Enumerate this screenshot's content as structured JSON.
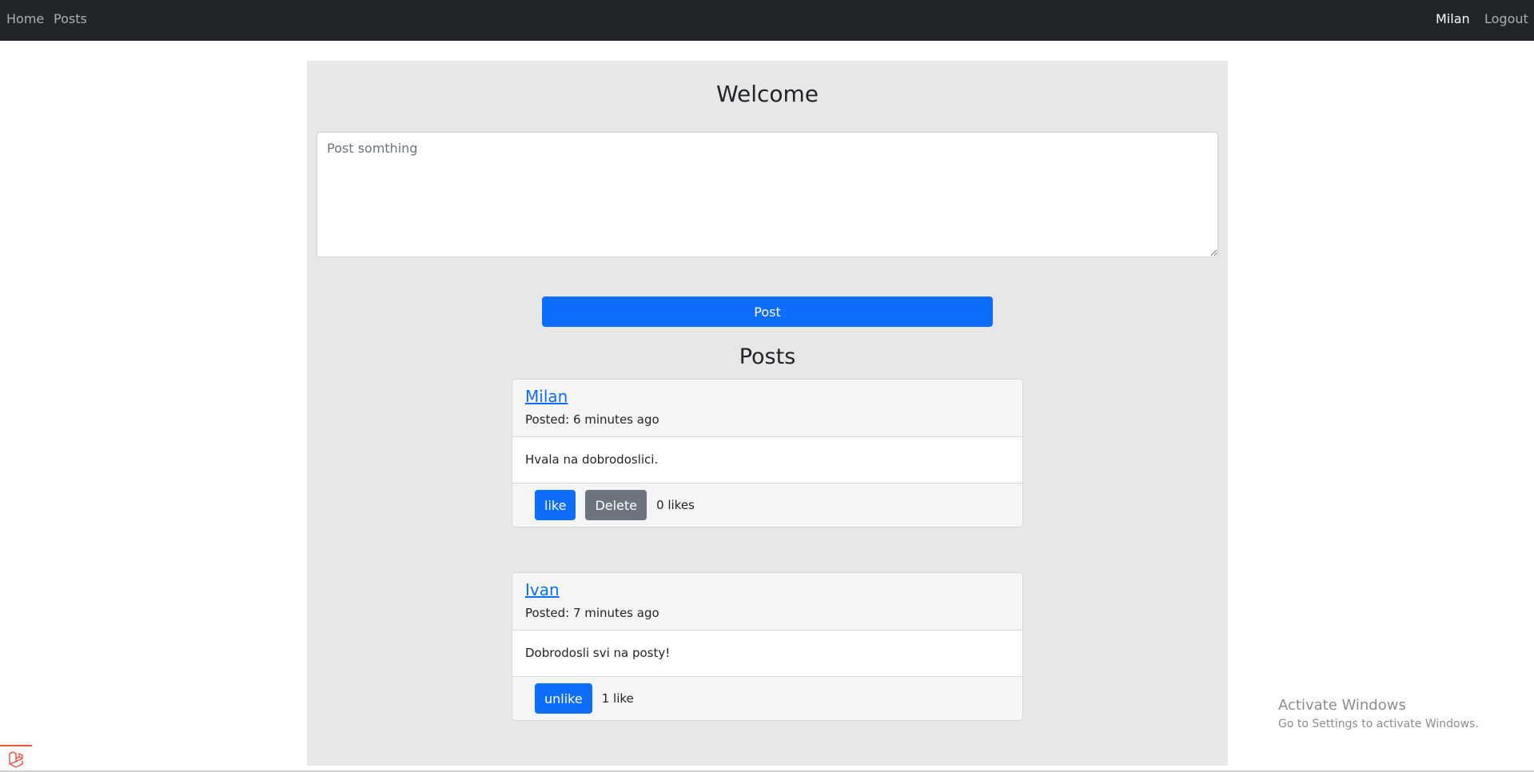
{
  "navbar": {
    "home_label": "Home",
    "posts_label": "Posts",
    "user_name": "Milan",
    "logout_label": "Logout"
  },
  "main": {
    "welcome_title": "Welcome",
    "compose": {
      "placeholder": "Post somthing",
      "value": ""
    },
    "post_button_label": "Post",
    "posts_heading": "Posts"
  },
  "posts": [
    {
      "author": "Milan",
      "posted": "Posted: 6 minutes ago",
      "body": "Hvala na dobrodoslici.",
      "like_button_label": "like",
      "delete_button_label": "Delete",
      "likes_text": "0 likes"
    },
    {
      "author": "Ivan",
      "posted": "Posted: 7 minutes ago",
      "body": "Dobrodosli svi na posty!",
      "like_button_label": "unlike",
      "likes_text": "1 like"
    }
  ],
  "watermark": {
    "title": "Activate Windows",
    "subtitle": "Go to Settings to activate Windows."
  },
  "icons": {
    "debugbar": "laravel-icon"
  },
  "colors": {
    "navbar_bg": "#212529",
    "primary": "#0d6efd",
    "secondary": "#6c757d",
    "content_bg": "#e7e7e7"
  }
}
